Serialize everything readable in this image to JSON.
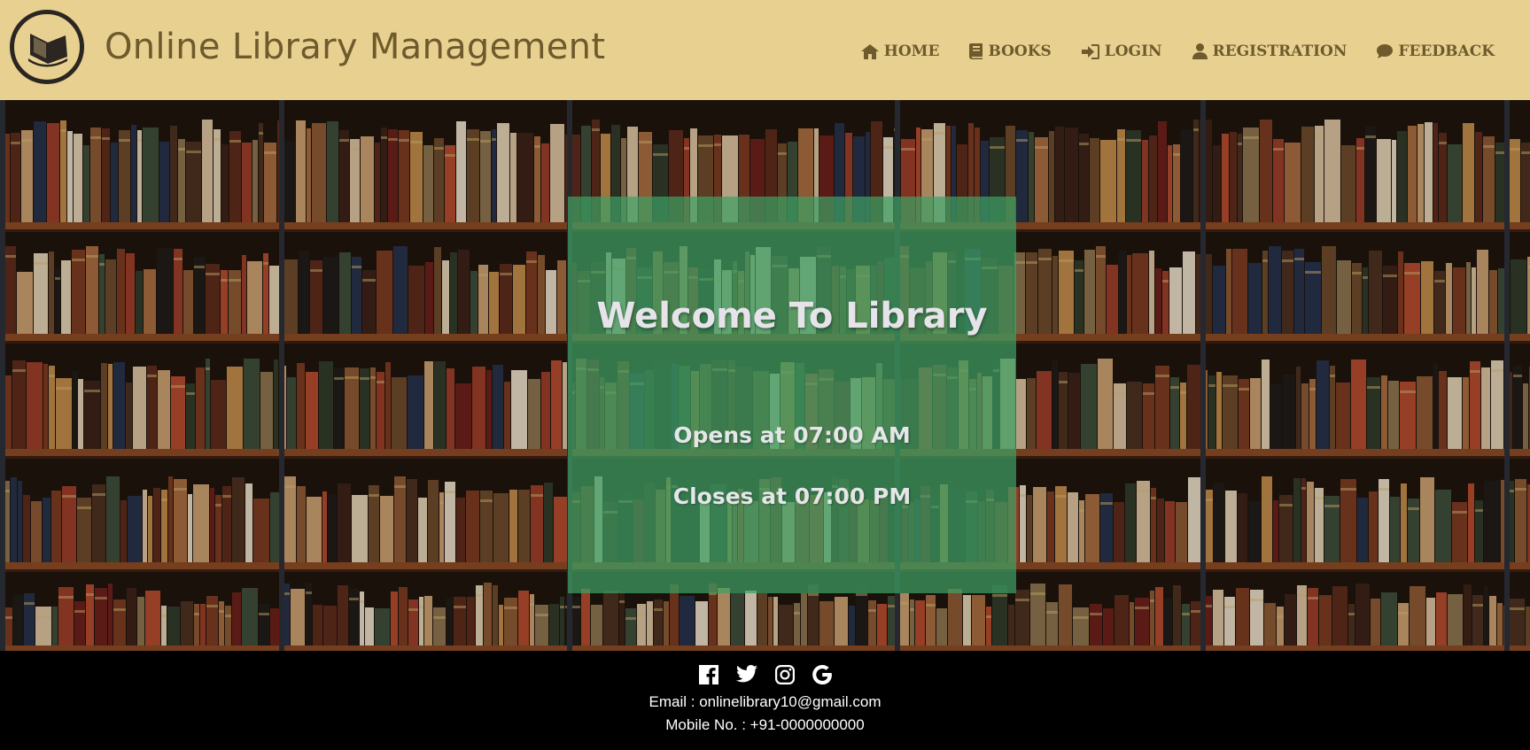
{
  "header": {
    "title": "Online Library Management",
    "logo_icon": "book-logo-icon",
    "background_color": "#e8d190",
    "text_color": "#6e5a2c"
  },
  "nav": [
    {
      "label": "HOME",
      "icon": "home-icon"
    },
    {
      "label": "BOOKS",
      "icon": "book-icon"
    },
    {
      "label": "LOGIN",
      "icon": "login-icon"
    },
    {
      "label": "REGISTRATION",
      "icon": "user-icon"
    },
    {
      "label": "FEEDBACK",
      "icon": "comment-icon"
    }
  ],
  "hero": {
    "background": "library-bookshelf-image",
    "title": "Welcome To Library",
    "opens": "Opens at 07:00 AM",
    "closes": "Closes at 07:00 PM",
    "overlay_color": "#3ea064"
  },
  "footer": {
    "social": [
      "facebook-icon",
      "twitter-icon",
      "instagram-icon",
      "google-icon"
    ],
    "email": "Email : onlinelibrary10@gmail.com",
    "mobile": "Mobile No. : +91-0000000000"
  }
}
